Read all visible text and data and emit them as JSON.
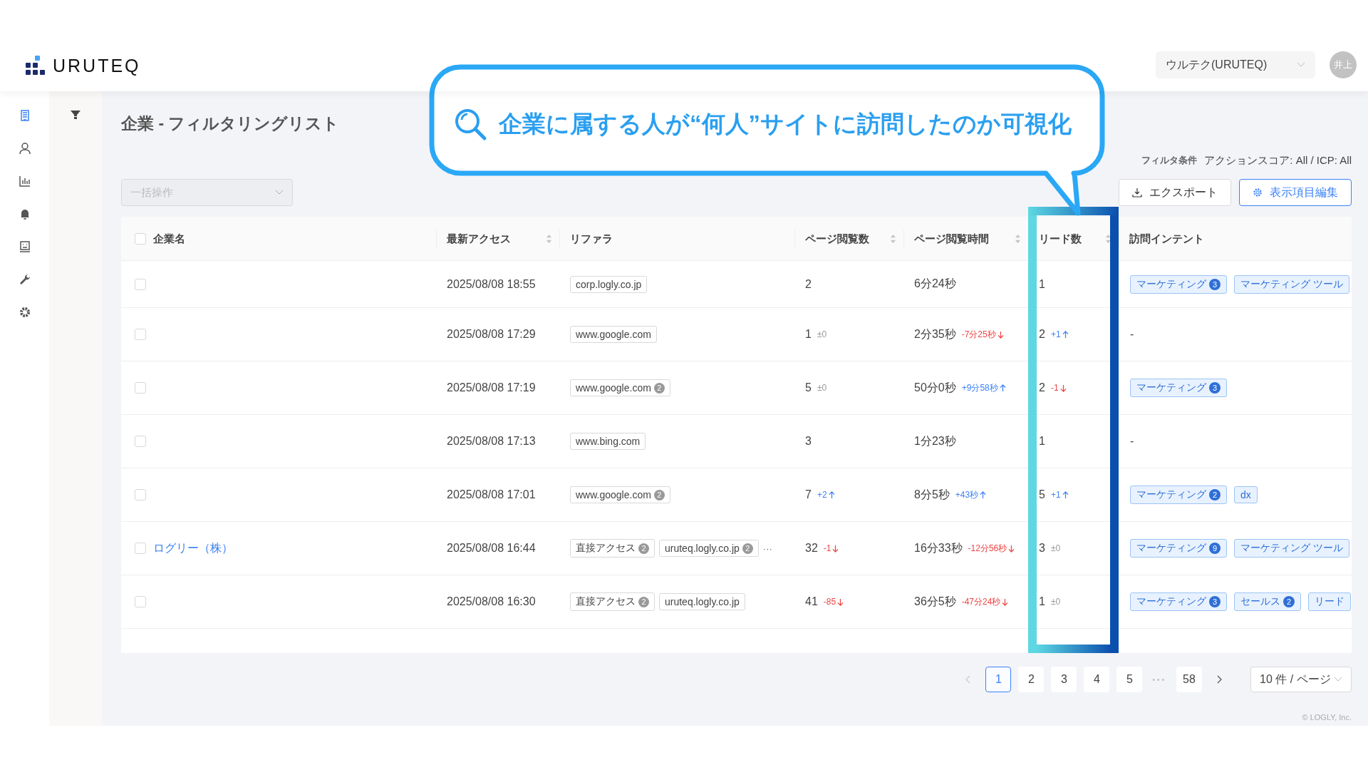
{
  "header": {
    "logo_text": "URUTEQ",
    "org_select": "ウルテク(URUTEQ)",
    "avatar": "井上"
  },
  "sidebar": {
    "items": [
      {
        "selected": true
      },
      {
        "selected": false
      },
      {
        "selected": false
      },
      {
        "selected": false
      },
      {
        "selected": false
      },
      {
        "selected": false
      },
      {
        "selected": false
      }
    ]
  },
  "callout": {
    "text": "企業に属する人が“何人”サイトに訪問したのか可視化"
  },
  "page_title": "企業 - フィルタリングリスト",
  "filter_conditions": {
    "label": "フィルタ条件",
    "value": "アクションスコア: All / ICP: All"
  },
  "bulk_action": {
    "placeholder": "一括操作",
    "disabled": true
  },
  "buttons": [
    {
      "kind": "export",
      "label": "エクスポート"
    },
    {
      "kind": "columns",
      "label": "表示項目編集"
    }
  ],
  "table": {
    "header_checkbox": {
      "checked": false
    },
    "columns": [
      {
        "label": "企業名",
        "sortable": false
      },
      {
        "label": "最新アクセス",
        "sortable": true
      },
      {
        "label": "リファラ",
        "sortable": false
      },
      {
        "label": "ページ閲覧数",
        "sortable": true
      },
      {
        "label": "ページ閲覧時間",
        "sortable": true
      },
      {
        "label": "リード数",
        "sortable": true,
        "highlighted": true
      },
      {
        "label": "訪問インテント",
        "sortable": false
      }
    ],
    "rows": [
      {
        "checked": false,
        "access": "2025/08/08 18:55",
        "referrers": [
          {
            "label": "corp.logly.co.jp"
          }
        ],
        "page_views": "2",
        "view_time": "6分24秒",
        "leads": "1",
        "intents": [
          {
            "label": "マーケティング",
            "count": "3"
          },
          {
            "label": "マーケティング ツール"
          }
        ]
      },
      {
        "checked": false,
        "access": "2025/08/08 17:29",
        "referrers": [
          {
            "label": "www.google.com"
          }
        ],
        "page_views": "1",
        "page_views_delta": {
          "text": "±0",
          "kind": "flat"
        },
        "view_time": "2分35秒",
        "view_time_delta": {
          "text": "-7分25秒",
          "kind": "down"
        },
        "leads": "2",
        "leads_delta": {
          "text": "+1",
          "kind": "up"
        },
        "intent_empty": "-"
      },
      {
        "checked": false,
        "access": "2025/08/08 17:19",
        "referrers": [
          {
            "label": "www.google.com",
            "count": "2"
          }
        ],
        "page_views": "5",
        "page_views_delta": {
          "text": "±0",
          "kind": "flat"
        },
        "view_time": "50分0秒",
        "view_time_delta": {
          "text": "+9分58秒",
          "kind": "up"
        },
        "leads": "2",
        "leads_delta": {
          "text": "-1",
          "kind": "down"
        },
        "intents": [
          {
            "label": "マーケティング",
            "count": "3"
          }
        ]
      },
      {
        "checked": false,
        "access": "2025/08/08 17:13",
        "referrers": [
          {
            "label": "www.bing.com"
          }
        ],
        "page_views": "3",
        "view_time": "1分23秒",
        "leads": "1",
        "intent_empty": "-"
      },
      {
        "checked": false,
        "access": "2025/08/08 17:01",
        "referrers": [
          {
            "label": "www.google.com",
            "count": "2"
          }
        ],
        "page_views": "7",
        "page_views_delta": {
          "text": "+2",
          "kind": "up"
        },
        "view_time": "8分5秒",
        "view_time_delta": {
          "text": "+43秒",
          "kind": "up"
        },
        "leads": "5",
        "leads_delta": {
          "text": "+1",
          "kind": "up"
        },
        "intents": [
          {
            "label": "マーケティング",
            "count": "2"
          },
          {
            "label": "dx"
          }
        ]
      },
      {
        "checked": false,
        "name": "ログリー（株）",
        "access": "2025/08/08 16:44",
        "referrers": [
          {
            "label": "直接アクセス",
            "count": "2"
          },
          {
            "label": "uruteq.logly.co.jp",
            "count": "2"
          }
        ],
        "referrers_more": "···",
        "page_views": "32",
        "page_views_delta": {
          "text": "-1",
          "kind": "down"
        },
        "view_time": "16分33秒",
        "view_time_delta": {
          "text": "-12分56秒",
          "kind": "down"
        },
        "leads": "3",
        "leads_delta": {
          "text": "±0",
          "kind": "flat"
        },
        "intents": [
          {
            "label": "マーケティング",
            "count": "9"
          },
          {
            "label": "マーケティング ツール"
          }
        ]
      },
      {
        "checked": false,
        "access": "2025/08/08 16:30",
        "referrers": [
          {
            "label": "直接アクセス",
            "count": "2"
          },
          {
            "label": "uruteq.logly.co.jp"
          }
        ],
        "page_views": "41",
        "page_views_delta": {
          "text": "-85",
          "kind": "down"
        },
        "view_time": "36分5秒",
        "view_time_delta": {
          "text": "-47分24秒",
          "kind": "down"
        },
        "leads": "1",
        "leads_delta": {
          "text": "±0",
          "kind": "flat"
        },
        "intents": [
          {
            "label": "マーケティング",
            "count": "3"
          },
          {
            "label": "セールス",
            "count": "2"
          },
          {
            "label": "リード"
          }
        ]
      }
    ]
  },
  "pagination": {
    "prev_disabled": true,
    "pages": [
      {
        "kind": "page",
        "label": "1",
        "selected": true
      },
      {
        "kind": "page",
        "label": "2",
        "selected": false
      },
      {
        "kind": "page",
        "label": "3",
        "selected": false
      },
      {
        "kind": "page",
        "label": "4",
        "selected": false
      },
      {
        "kind": "page",
        "label": "5",
        "selected": false
      },
      {
        "kind": "ellipsis",
        "label": "•••",
        "selected": false
      },
      {
        "kind": "page",
        "label": "58",
        "selected": false
      }
    ],
    "page_size": "10 件 / ページ"
  },
  "footer": {
    "copyright": "© LOGLY, Inc."
  }
}
